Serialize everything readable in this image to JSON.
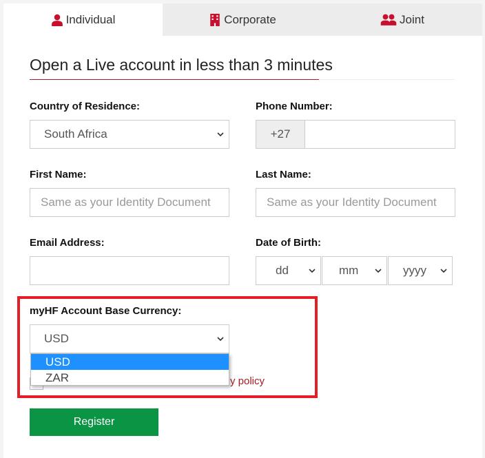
{
  "tabs": [
    {
      "label": "Individual",
      "icon": "user-icon",
      "active": true
    },
    {
      "label": "Corporate",
      "icon": "building-icon"
    },
    {
      "label": "Joint",
      "icon": "users-icon"
    }
  ],
  "title": "Open a Live account in less than 3 minutes",
  "form": {
    "country": {
      "label": "Country of Residence:",
      "value": "South Africa"
    },
    "phone": {
      "label": "Phone Number:",
      "prefix": "+27",
      "value": ""
    },
    "first_name": {
      "label": "First Name:",
      "placeholder": "Same as your Identity Document"
    },
    "last_name": {
      "label": "Last Name:",
      "placeholder": "Same as your Identity Document"
    },
    "email": {
      "label": "Email Address:",
      "value": ""
    },
    "dob": {
      "label": "Date of Birth:",
      "day": "dd",
      "month": "mm",
      "year": "yyyy"
    },
    "currency": {
      "label": "myHF Account Base Currency:",
      "value": "USD",
      "options": [
        "USD",
        "ZAR"
      ],
      "highlighted": "USD"
    },
    "policy_fragment": "y policy",
    "register": "Register"
  },
  "colors": {
    "accent": "#c8102e",
    "highlight": "#e31e24",
    "button": "#0b9444",
    "selected_option": "#1e90ff"
  }
}
